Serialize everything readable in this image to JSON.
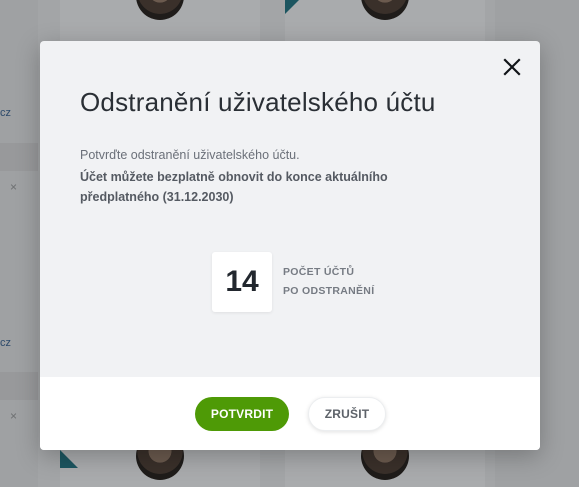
{
  "background": {
    "fragments": [
      "cz",
      "cz"
    ],
    "close_glyph": "×"
  },
  "modal": {
    "title": "Odstranění uživatelského účtu",
    "description": "Potvrďte odstranění uživatelského účtu.",
    "note": "Účet můžete bezplatně obnovit do konce aktuálního předplatného (31.12.2030)",
    "count_value": "14",
    "count_label_line1": "POČET ÚČTŮ",
    "count_label_line2": "PO ODSTRANĚNÍ",
    "close_icon": "close-icon",
    "confirm_label": "POTVRDIT",
    "cancel_label": "ZRUŠIT"
  },
  "colors": {
    "accent_green": "#4e9a06",
    "modal_bg": "#f1f2f4",
    "footer_bg": "#ffffff"
  }
}
